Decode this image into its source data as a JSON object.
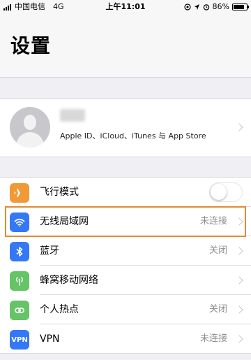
{
  "status_bar": {
    "carrier": "中国电信",
    "network": "4G",
    "time": "上午11:01",
    "battery_percent": "86%",
    "battery_level": 0.86,
    "icons": [
      "signal-icon",
      "location-icon",
      "alarm-icon",
      "battery-icon"
    ]
  },
  "header": {
    "title": "设置"
  },
  "profile": {
    "subtitle": "Apple ID、iCloud、iTunes 与 App Store"
  },
  "settings": [
    {
      "label": "飞行模式",
      "icon": "airplane-icon",
      "color": "#f09a37",
      "toggle": false
    },
    {
      "label": "无线局域网",
      "icon": "wifi-icon",
      "color": "#3478f6",
      "value": "未连接"
    },
    {
      "label": "蓝牙",
      "icon": "bluetooth-icon",
      "color": "#3478f6",
      "value": "关闭"
    },
    {
      "label": "蜂窝移动网络",
      "icon": "cellular-icon",
      "color": "#65c466",
      "value": ""
    },
    {
      "label": "个人热点",
      "icon": "hotspot-icon",
      "color": "#65c466",
      "value": "关闭"
    },
    {
      "label": "VPN",
      "icon": "vpn-icon",
      "color": "#3478f6",
      "value": "未连接",
      "icon_text": "VPN"
    }
  ],
  "colors": {
    "highlight": "#e7892e",
    "background": "#efeff4"
  }
}
